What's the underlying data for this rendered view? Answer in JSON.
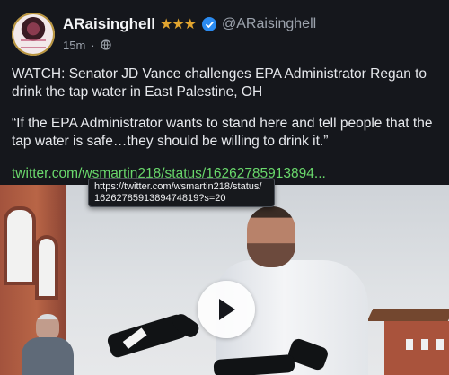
{
  "post": {
    "display_name": "ARaisinghell",
    "stars": "★★★",
    "handle": "@ARaisinghell",
    "time": "15m",
    "text": [
      "WATCH: Senator JD Vance challenges EPA Administrator Regan to drink the tap water in East Palestine, OH",
      "“If the EPA Administrator wants to stand here and tell people that the tap water is safe…they should be willing to drink it.”"
    ],
    "link": "twitter.com/wsmartin218/status/16262785913894..."
  },
  "tooltip": {
    "lines": [
      "https://twitter.com/wsmartin218/status/",
      "1626278591389474819?s=20"
    ]
  },
  "colors": {
    "background": "#15171c",
    "link": "#6ad96c",
    "stars": "#e2a52f",
    "verified": "#2b8bf0"
  },
  "icons": [
    "verified-badge-icon",
    "globe-icon",
    "play-icon"
  ]
}
